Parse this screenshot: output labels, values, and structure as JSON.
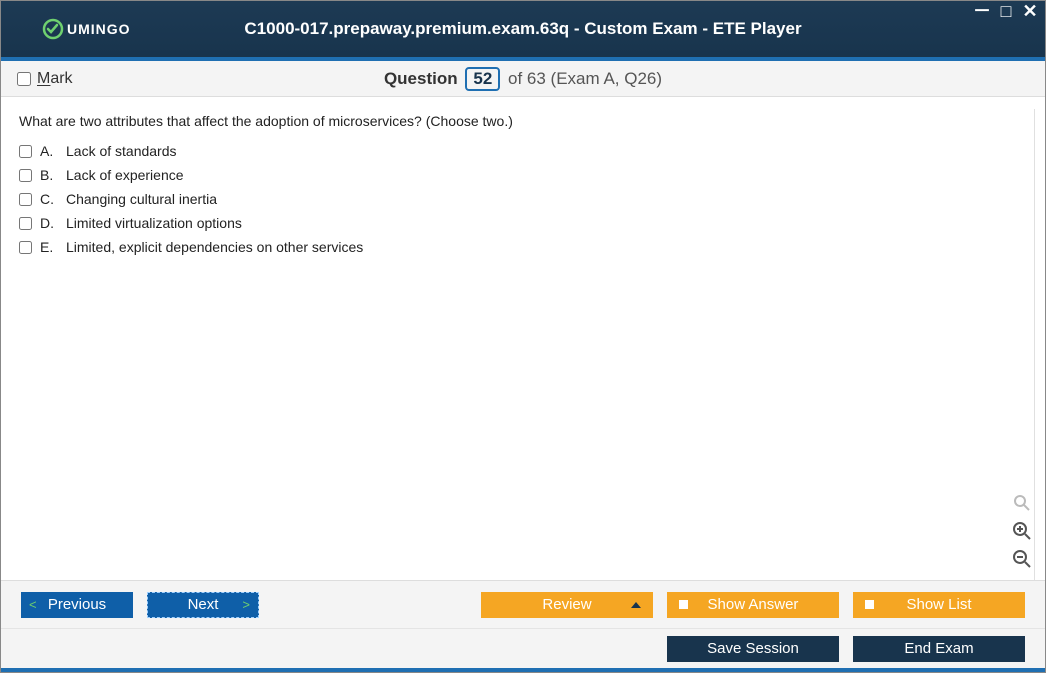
{
  "window": {
    "title": "C1000-017.prepaway.premium.exam.63q - Custom Exam - ETE Player",
    "logo_text": "UMINGO"
  },
  "header": {
    "mark_label": "Mark",
    "question_word": "Question",
    "current_num": "52",
    "of_text": "of 63 (Exam A, Q26)"
  },
  "question": {
    "prompt": "What are two attributes that affect the adoption of microservices? (Choose two.)",
    "answers": [
      {
        "letter": "A.",
        "text": "Lack of standards"
      },
      {
        "letter": "B.",
        "text": "Lack of experience"
      },
      {
        "letter": "C.",
        "text": "Changing cultural inertia"
      },
      {
        "letter": "D.",
        "text": "Limited virtualization options"
      },
      {
        "letter": "E.",
        "text": "Limited, explicit dependencies on other services"
      }
    ]
  },
  "footer": {
    "previous": "Previous",
    "next": "Next",
    "review": "Review",
    "show_answer": "Show Answer",
    "show_list": "Show List",
    "save_session": "Save Session",
    "end_exam": "End Exam"
  }
}
